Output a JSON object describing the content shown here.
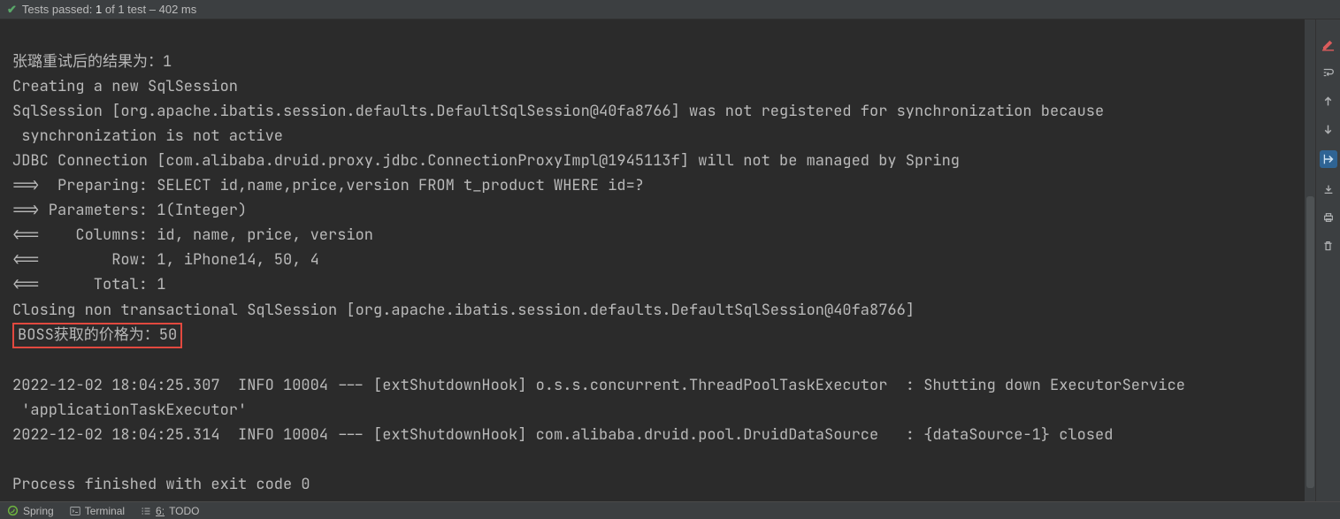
{
  "status_bar": {
    "prefix": "Tests passed:",
    "count": "1",
    "of_text": "of 1 test –",
    "time": "402 ms"
  },
  "console": {
    "l1": "张璐重试后的结果为：1",
    "l2": "Creating a new SqlSession",
    "l3": "SqlSession [org.apache.ibatis.session.defaults.DefaultSqlSession@40fa8766] was not registered for synchronization because",
    "l4": " synchronization is not active",
    "l5": "JDBC Connection [com.alibaba.druid.proxy.jdbc.ConnectionProxyImpl@1945113f] will not be managed by Spring",
    "l6": "==>  Preparing: SELECT id,name,price,version FROM t_product WHERE id=?",
    "l7": "==> Parameters: 1(Integer)",
    "l8": "<==    Columns: id, name, price, version",
    "l9": "<==        Row: 1, iPhone14, 50, 4",
    "l10": "<==      Total: 1",
    "l11": "Closing non transactional SqlSession [org.apache.ibatis.session.defaults.DefaultSqlSession@40fa8766]",
    "l12": "BOSS获取的价格为：50",
    "l13": "",
    "l14": "2022-12-02 18:04:25.307  INFO 10004 --- [extShutdownHook] o.s.s.concurrent.ThreadPoolTaskExecutor  : Shutting down ExecutorService",
    "l15": " 'applicationTaskExecutor'",
    "l16": "2022-12-02 18:04:25.314  INFO 10004 --- [extShutdownHook] com.alibaba.druid.pool.DruidDataSource   : {dataSource-1} closed",
    "l17": "",
    "l18": "Process finished with exit code 0"
  },
  "bottom": {
    "spring": "Spring",
    "terminal": "Terminal",
    "todo_prefix": "6:",
    "todo": "TODO"
  }
}
